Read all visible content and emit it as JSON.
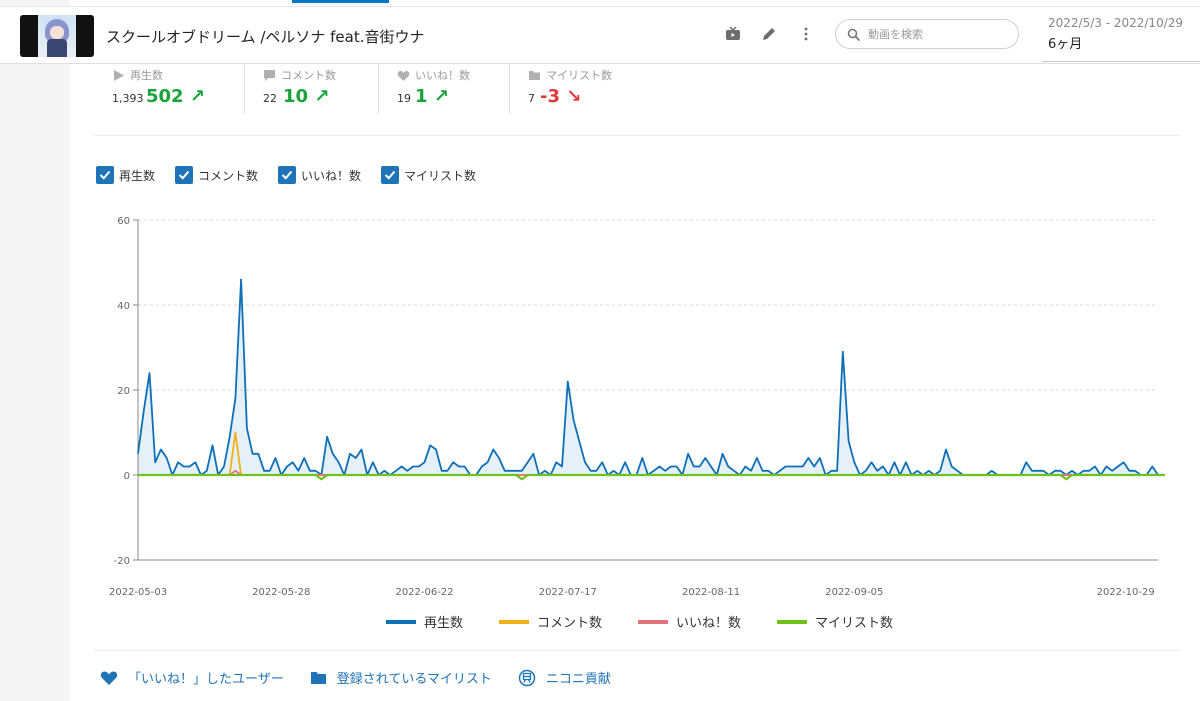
{
  "header": {
    "title": "スクールオブドリーム /ペルソナ feat.音街ウナ",
    "search_placeholder": "動画を検索",
    "date_range": "2022/5/3 - 2022/10/29",
    "period": "6ヶ月"
  },
  "stats": [
    {
      "label": "再生数",
      "total": "1,393",
      "delta": "502",
      "trend": "up",
      "icon": "play-icon"
    },
    {
      "label": "コメント数",
      "total": "22",
      "delta": "10",
      "trend": "up",
      "icon": "comment-icon"
    },
    {
      "label": "いいね！数",
      "total": "19",
      "delta": "1",
      "trend": "up",
      "icon": "heart-icon"
    },
    {
      "label": "マイリスト数",
      "total": "7",
      "delta": "-3",
      "trend": "down",
      "icon": "folder-icon"
    }
  ],
  "filters": [
    {
      "label": "再生数",
      "checked": true
    },
    {
      "label": "コメント数",
      "checked": true
    },
    {
      "label": "いいね！数",
      "checked": true
    },
    {
      "label": "マイリスト数",
      "checked": true
    }
  ],
  "legend": [
    {
      "label": "再生数",
      "color": "#0d6fb8"
    },
    {
      "label": "コメント数",
      "color": "#f2b018"
    },
    {
      "label": "いいね！数",
      "color": "#e5707a"
    },
    {
      "label": "マイリスト数",
      "color": "#6fc21a"
    }
  ],
  "links": [
    {
      "label": "「いいね！」したユーザー",
      "icon": "heart-icon"
    },
    {
      "label": "登録されているマイリスト",
      "icon": "folder-icon"
    },
    {
      "label": "ニコニ貢献",
      "icon": "contribution-icon"
    }
  ],
  "chart_data": {
    "type": "line",
    "x_start": "2022-05-03",
    "x_tick_labels": [
      "2022-05-03",
      "2022-05-28",
      "2022-06-22",
      "2022-07-17",
      "2022-08-11",
      "2022-09-05",
      "2022-10-29"
    ],
    "y_ticks": [
      60,
      40,
      20,
      0,
      -20
    ],
    "ylim": [
      -20,
      60
    ],
    "grid": true,
    "legend_position": "bottom",
    "series": [
      {
        "name": "再生数",
        "color": "#0d6fb8",
        "fill": true,
        "values": [
          5,
          15,
          24,
          3,
          6,
          4,
          0,
          3,
          2,
          2,
          3,
          0,
          1,
          7,
          0,
          2,
          9,
          18,
          46,
          11,
          5,
          5,
          1,
          1,
          4,
          0,
          2,
          3,
          1,
          4,
          1,
          1,
          0,
          9,
          5,
          3,
          0,
          5,
          4,
          6,
          0,
          3,
          0,
          1,
          0,
          1,
          2,
          1,
          2,
          2,
          3,
          7,
          6,
          1,
          1,
          3,
          2,
          2,
          0,
          0,
          2,
          3,
          6,
          4,
          1,
          1,
          1,
          1,
          3,
          5,
          0,
          1,
          0,
          3,
          2,
          22,
          13,
          8,
          3,
          1,
          1,
          3,
          0,
          1,
          0,
          3,
          0,
          0,
          4,
          0,
          1,
          2,
          1,
          2,
          2,
          0,
          5,
          2,
          2,
          4,
          2,
          0,
          5,
          2,
          1,
          0,
          2,
          1,
          4,
          1,
          1,
          0,
          1,
          2,
          2,
          2,
          2,
          4,
          2,
          4,
          0,
          1,
          1,
          29,
          8,
          3,
          0,
          1,
          3,
          1,
          2,
          0,
          3,
          0,
          3,
          0,
          1,
          0,
          1,
          0,
          1,
          6,
          2,
          1,
          0,
          0,
          0,
          0,
          0,
          1,
          0,
          0,
          0,
          0,
          0,
          3,
          1,
          1,
          1,
          0,
          1,
          1,
          0,
          1,
          0,
          1,
          1,
          2,
          0,
          2,
          1,
          2,
          3,
          1,
          1,
          0,
          0,
          2,
          0
        ]
      },
      {
        "name": "コメント数",
        "color": "#f2b018",
        "fill": false,
        "values": [
          0,
          0,
          0,
          0,
          0,
          0,
          0,
          0,
          0,
          0,
          0,
          0,
          0,
          0,
          0,
          0,
          0,
          10,
          0,
          0,
          0,
          0,
          0,
          0,
          0,
          0,
          0,
          0,
          0,
          0,
          0,
          0,
          0,
          0,
          0,
          0,
          0,
          0,
          0,
          0,
          0,
          0,
          0,
          0,
          0,
          0,
          0,
          0,
          0,
          0,
          0,
          0,
          0,
          0,
          0,
          0,
          0,
          0,
          0,
          0,
          0,
          0,
          0,
          0,
          0,
          0,
          0,
          0,
          0,
          0,
          0,
          0,
          0,
          0,
          0,
          0,
          0,
          0,
          0,
          0,
          0,
          0,
          0,
          0,
          0,
          0,
          0,
          0,
          0,
          0,
          0,
          0,
          0,
          0,
          0,
          0,
          0,
          0,
          0,
          0,
          0,
          0,
          0,
          0,
          0,
          0,
          0,
          0,
          0,
          0,
          0,
          0,
          0,
          0,
          0,
          0,
          0,
          0,
          0,
          0,
          0,
          0,
          0,
          0,
          0,
          0,
          0,
          0,
          0,
          0,
          0,
          0,
          0,
          0,
          0,
          0,
          0,
          0,
          0,
          0,
          0,
          0,
          0,
          0,
          0,
          0,
          0,
          0,
          0,
          0,
          0,
          0,
          0,
          0,
          0,
          0,
          0,
          0,
          0,
          0,
          0,
          0,
          0,
          0,
          0,
          0,
          0,
          0,
          0,
          0,
          0,
          0,
          0,
          0,
          0,
          0,
          0,
          0,
          0,
          0
        ]
      },
      {
        "name": "いいね！数",
        "color": "#e5707a",
        "fill": false,
        "values": [
          0,
          0,
          0,
          0,
          0,
          0,
          0,
          0,
          0,
          0,
          0,
          0,
          0,
          0,
          0,
          0,
          0,
          1,
          0,
          0,
          0,
          0,
          0,
          0,
          0,
          0,
          0,
          0,
          0,
          0,
          0,
          0,
          0,
          0,
          0,
          0,
          0,
          0,
          0,
          0,
          0,
          0,
          0,
          0,
          0,
          0,
          0,
          0,
          0,
          0,
          0,
          0,
          0,
          0,
          0,
          0,
          0,
          0,
          0,
          0,
          0,
          0,
          0,
          0,
          0,
          0,
          0,
          0,
          0,
          0,
          0,
          0,
          0,
          0,
          0,
          0,
          0,
          0,
          0,
          0,
          0,
          0,
          0,
          0,
          0,
          0,
          0,
          0,
          0,
          0,
          0,
          0,
          0,
          0,
          0,
          0,
          0,
          0,
          0,
          0,
          0,
          0,
          0,
          0,
          0,
          0,
          0,
          0,
          0,
          0,
          0,
          0,
          0,
          0,
          0,
          0,
          0,
          0,
          0,
          0,
          0,
          0,
          0,
          0,
          0,
          0,
          0,
          0,
          0,
          0,
          0,
          0,
          0,
          0,
          0,
          0,
          0,
          0,
          0,
          0,
          0,
          0,
          0,
          0,
          0,
          0,
          0,
          0,
          0,
          0,
          0,
          0,
          0,
          0,
          0,
          0,
          0,
          0,
          0,
          0,
          0,
          0,
          0,
          0,
          0,
          0,
          0,
          0,
          0,
          0,
          0,
          0,
          0,
          0,
          0,
          0,
          0,
          0,
          0,
          0
        ]
      },
      {
        "name": "マイリスト数",
        "color": "#6fc21a",
        "fill": false,
        "values": [
          0,
          0,
          0,
          0,
          0,
          0,
          0,
          0,
          0,
          0,
          0,
          0,
          0,
          0,
          0,
          0,
          0,
          0,
          0,
          0,
          0,
          0,
          0,
          0,
          0,
          0,
          0,
          0,
          0,
          0,
          0,
          0,
          -1,
          0,
          0,
          0,
          0,
          0,
          0,
          0,
          0,
          0,
          0,
          0,
          0,
          0,
          0,
          0,
          0,
          0,
          0,
          0,
          0,
          0,
          0,
          0,
          0,
          0,
          0,
          0,
          0,
          0,
          0,
          0,
          0,
          0,
          0,
          -1,
          0,
          0,
          0,
          0,
          0,
          0,
          0,
          0,
          0,
          0,
          0,
          0,
          0,
          0,
          0,
          0,
          0,
          0,
          0,
          0,
          0,
          0,
          0,
          0,
          0,
          0,
          0,
          0,
          0,
          0,
          0,
          0,
          0,
          0,
          0,
          0,
          0,
          0,
          0,
          0,
          0,
          0,
          0,
          0,
          0,
          0,
          0,
          0,
          0,
          0,
          0,
          0,
          0,
          0,
          0,
          0,
          0,
          0,
          0,
          0,
          0,
          0,
          0,
          0,
          0,
          0,
          0,
          0,
          0,
          0,
          0,
          0,
          0,
          0,
          0,
          0,
          0,
          0,
          0,
          0,
          0,
          0,
          0,
          0,
          0,
          0,
          0,
          0,
          0,
          0,
          0,
          0,
          0,
          0,
          -1,
          0,
          0,
          0,
          0,
          0,
          0,
          0,
          0,
          0,
          0,
          0,
          0,
          0,
          0,
          0,
          0,
          0,
          0,
          0
        ]
      }
    ]
  }
}
